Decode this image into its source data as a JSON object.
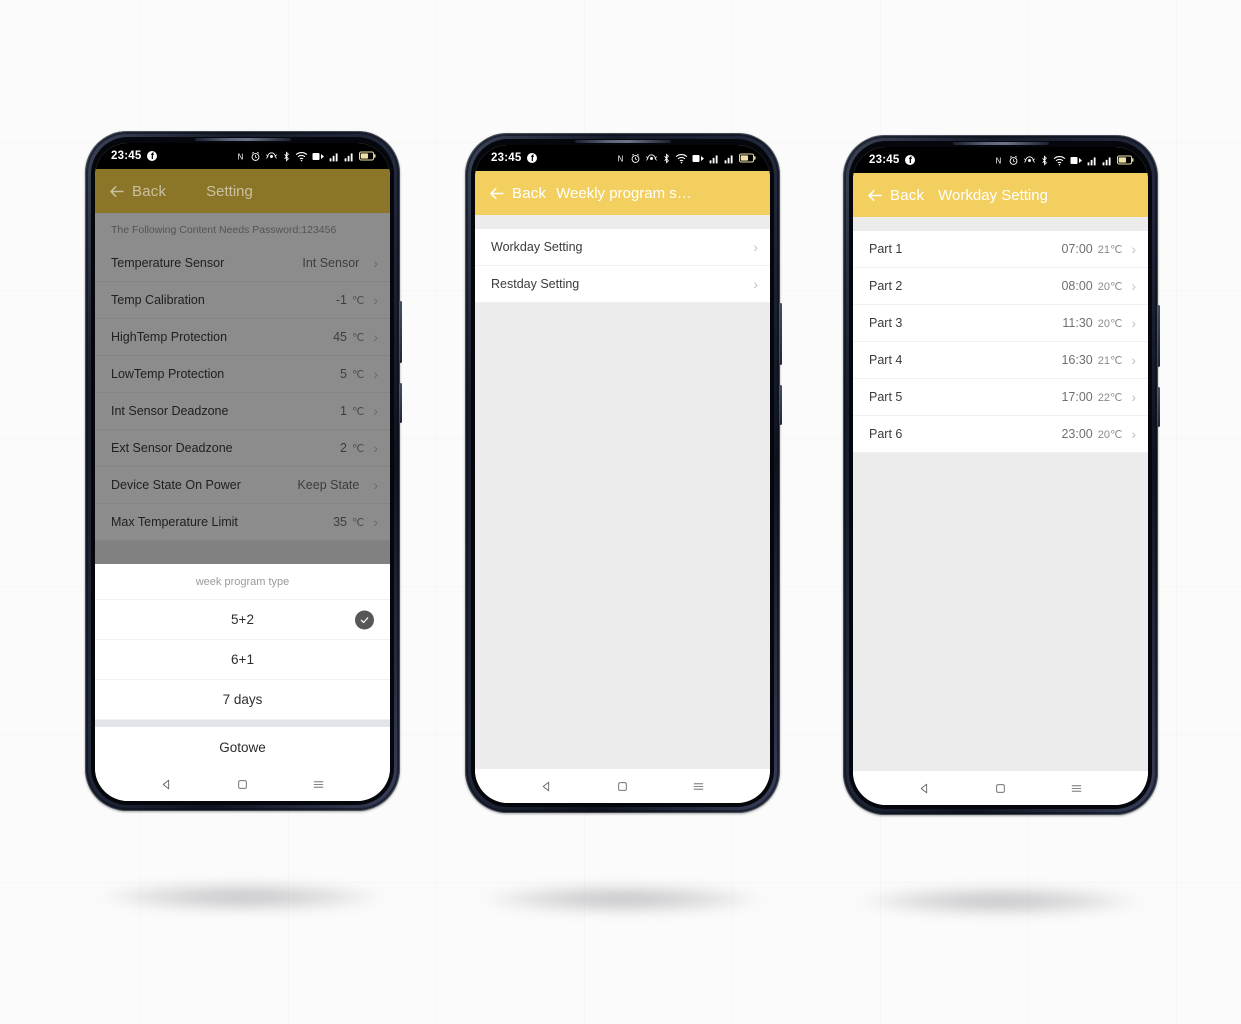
{
  "statusbar": {
    "time": "23:45",
    "facebook_badge": "f",
    "icons": [
      "nfc-icon",
      "alarm-icon",
      "location-icon",
      "bluetooth-icon",
      "wifi-icon",
      "volte-icon",
      "signal-1-icon",
      "signal-2-icon",
      "battery-icon"
    ]
  },
  "navbar": {
    "back": "back-triangle-icon",
    "home": "home-square-icon",
    "recents": "menu-lines-icon"
  },
  "phones": [
    {
      "id": "phone-settings",
      "appbar": {
        "back_label": "Back",
        "title": "Setting",
        "bg": "#8a7528",
        "dimmed": true
      },
      "hint": "The Following Content Needs Password:123456",
      "rows": [
        {
          "label": "Temperature Sensor",
          "value": "Int Sensor",
          "unit": ""
        },
        {
          "label": "Temp Calibration",
          "value": "-1",
          "unit": "℃"
        },
        {
          "label": "HighTemp Protection",
          "value": "45",
          "unit": "℃"
        },
        {
          "label": "LowTemp Protection",
          "value": "5",
          "unit": "℃"
        },
        {
          "label": "Int Sensor Deadzone",
          "value": "1",
          "unit": "℃"
        },
        {
          "label": "Ext Sensor Deadzone",
          "value": "2",
          "unit": "℃"
        },
        {
          "label": "Device State On Power",
          "value": "Keep State",
          "unit": ""
        },
        {
          "label": "Max Temperature Limit",
          "value": "35",
          "unit": "℃"
        }
      ],
      "sheet": {
        "title": "week program type",
        "options": [
          {
            "label": "5+2",
            "selected": true
          },
          {
            "label": "6+1",
            "selected": false
          },
          {
            "label": "7 days",
            "selected": false
          }
        ],
        "done_label": "Gotowe"
      }
    },
    {
      "id": "phone-weekly",
      "appbar": {
        "back_label": "Back",
        "title": "Weekly program s…",
        "bg": "#f3cf5f",
        "dimmed": false
      },
      "rows": [
        {
          "label": "Workday Setting",
          "value": "",
          "unit": ""
        },
        {
          "label": "Restday Setting",
          "value": "",
          "unit": ""
        }
      ]
    },
    {
      "id": "phone-workday",
      "appbar": {
        "back_label": "Back",
        "title": "Workday Setting",
        "bg": "#f3cf5f",
        "dimmed": false
      },
      "rows": [
        {
          "label": "Part 1",
          "value": "07:00",
          "unit": "21℃"
        },
        {
          "label": "Part 2",
          "value": "08:00",
          "unit": "20℃"
        },
        {
          "label": "Part 3",
          "value": "11:30",
          "unit": "20℃"
        },
        {
          "label": "Part 4",
          "value": "16:30",
          "unit": "21℃"
        },
        {
          "label": "Part 5",
          "value": "17:00",
          "unit": "22℃"
        },
        {
          "label": "Part 6",
          "value": "23:00",
          "unit": "20℃"
        }
      ]
    }
  ],
  "colors": {
    "accent_yellow": "#f3cf5f",
    "accent_yellow_dim": "#8a7528",
    "page_bg": "#ececec",
    "canvas_bg": "#fbfbfb",
    "check_circle": "#575757"
  }
}
